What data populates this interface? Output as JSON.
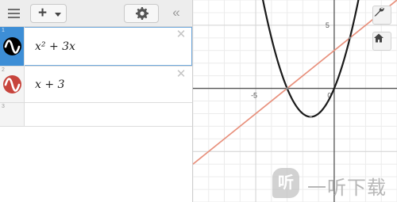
{
  "toolbar": {
    "menu_icon": "hamburger-icon",
    "add_button": {
      "label": "+",
      "icon": "chevron-down-icon"
    },
    "settings_icon": "gear-icon",
    "collapse_label": "«"
  },
  "expressions": [
    {
      "index": "1",
      "latex_text": "x² + 3x",
      "color": "#000000",
      "active": true
    },
    {
      "index": "2",
      "latex_text": "x + 3",
      "color": "#c7443c",
      "active": false
    },
    {
      "index": "3",
      "latex_text": "",
      "color": "",
      "active": false
    }
  ],
  "graph": {
    "x_tick_labels": [
      "-5",
      "0"
    ],
    "y_tick_labels": [
      "5"
    ],
    "x_range": [
      -9,
      4
    ],
    "y_range": [
      -9,
      7
    ],
    "grid": true,
    "curves": [
      {
        "name": "x² + 3x",
        "color": "#1a1a1a"
      },
      {
        "name": "x + 3",
        "color": "#e8907c"
      }
    ],
    "tools": {
      "wrench_icon": "wrench-icon",
      "home_icon": "home-icon"
    }
  },
  "watermark": {
    "logo_text": "听",
    "text": "一听下载"
  }
}
